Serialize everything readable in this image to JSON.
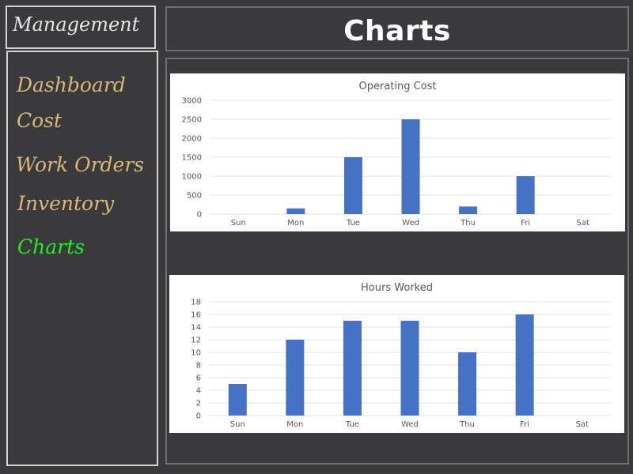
{
  "sidebar": {
    "brand": "Management",
    "items": [
      {
        "label": "Dashboard",
        "color": "#d6b878",
        "active": false
      },
      {
        "label": "Cost",
        "color": "#d6b878",
        "active": false
      },
      {
        "label": "Work Orders",
        "color": "#d6b878",
        "active": false
      },
      {
        "label": "Inventory",
        "color": "#d6b878",
        "active": false
      },
      {
        "label": "Charts",
        "color": "#22ee22",
        "active": true
      }
    ]
  },
  "header": {
    "title": "Charts"
  },
  "colors": {
    "bar": "#4472c4",
    "background": "#3a3a3c"
  },
  "chart_data": [
    {
      "type": "bar",
      "title": "Operating Cost",
      "categories": [
        "Sun",
        "Mon",
        "Tue",
        "Wed",
        "Thu",
        "Fri",
        "Sat"
      ],
      "values": [
        0,
        150,
        1500,
        2500,
        200,
        1000,
        0
      ],
      "yticks": [
        0,
        500,
        1000,
        1500,
        2000,
        2500,
        3000
      ],
      "ylim": [
        0,
        3000
      ],
      "grid": true,
      "xlabel": "",
      "ylabel": ""
    },
    {
      "type": "bar",
      "title": "Hours Worked",
      "categories": [
        "Sun",
        "Mon",
        "Tue",
        "Wed",
        "Thu",
        "Fri",
        "Sat"
      ],
      "values": [
        5,
        12,
        15,
        15,
        10,
        16,
        0
      ],
      "yticks": [
        0,
        2,
        4,
        6,
        8,
        10,
        12,
        14,
        16,
        18
      ],
      "ylim": [
        0,
        18
      ],
      "grid": true,
      "xlabel": "",
      "ylabel": ""
    }
  ]
}
